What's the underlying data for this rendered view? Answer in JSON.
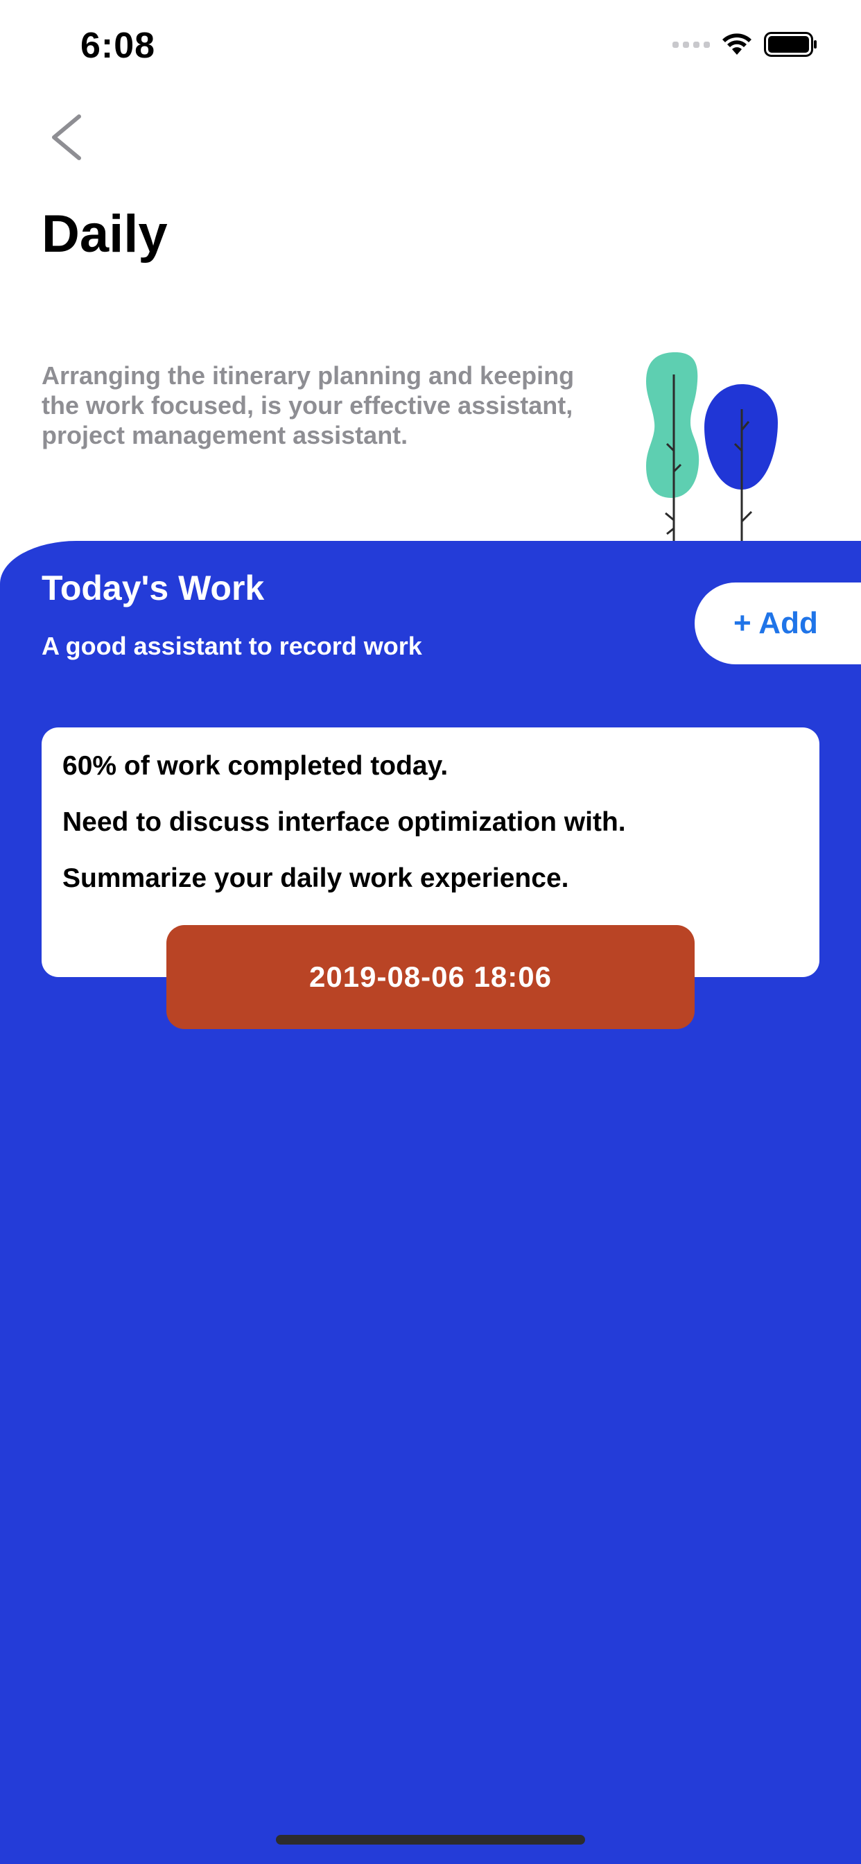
{
  "status_bar": {
    "time": "6:08"
  },
  "header": {
    "title": "Daily",
    "back_icon": "chevron-left-icon"
  },
  "intro": {
    "text": "Arranging the itinerary planning and keeping the work focused, is your effective assistant, project management assistant."
  },
  "illustration": {
    "icon": "trees-illustration",
    "colors": [
      "#5ecfb1",
      "#2036d6"
    ]
  },
  "work_section": {
    "title": "Today's Work",
    "subtitle": "A good assistant to record work",
    "add_label": "+ Add"
  },
  "work_card": {
    "lines": [
      "60% of work completed today.",
      "Need to discuss interface optimization with.",
      "Summarize your daily work experience."
    ],
    "datetime": "2019-08-06 18:06"
  },
  "colors": {
    "panel": "#243cd8",
    "date_pill": "#b94425",
    "add_text": "#1f74e8",
    "intro_text": "#8e8e93"
  }
}
